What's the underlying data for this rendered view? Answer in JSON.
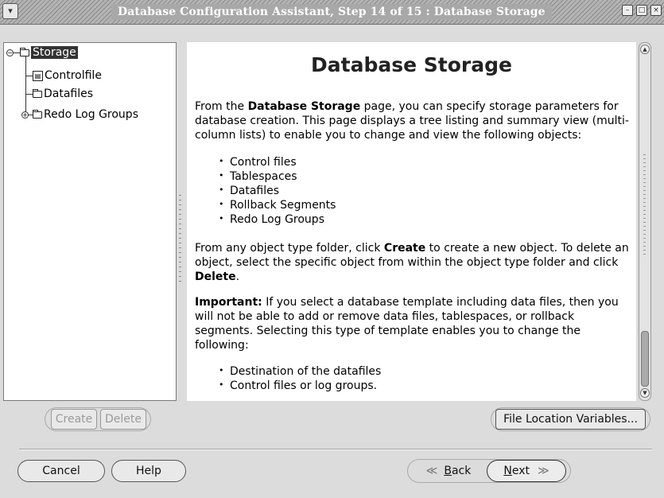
{
  "window": {
    "title": "Database Configuration Assistant, Step 14 of 15 : Database Storage",
    "menu_glyph": "▾",
    "minimize_glyph": "–",
    "maximize_glyph": "□",
    "close_glyph": "×"
  },
  "tree": {
    "root_label": "Storage",
    "items": [
      {
        "label": "Controlfile",
        "icon": "controlfile-icon"
      },
      {
        "label": "Datafiles",
        "icon": "folder-icon"
      },
      {
        "label": "Redo Log Groups",
        "icon": "folder-icon",
        "expandable": true
      }
    ],
    "collapse_glyph": "−",
    "expand_glyph": "+"
  },
  "help": {
    "heading": "Database Storage",
    "p1_pre": "From the ",
    "p1_bold": "Database Storage",
    "p1_post": " page, you can specify storage parameters for database creation. This page displays a tree listing and summary view (multi-column lists) to enable you to change and view the following objects:",
    "list1": [
      "Control files",
      "Tablespaces",
      "Datafiles",
      "Rollback Segments",
      "Redo Log Groups"
    ],
    "p2_pre": "From any object type folder, click ",
    "p2_bold1": "Create",
    "p2_mid": " to create a new object. To delete an object, select the specific object from within the object type folder and click ",
    "p2_bold2": "Delete",
    "p2_post": ".",
    "p3_bold": "Important:",
    "p3_post": " If you select a database template including data files, then you will not be able to add or remove data files, tablespaces, or rollback segments. Selecting this type of template enables you to change the following:",
    "list2": [
      "Destination of the datafiles",
      "Control files or log groups."
    ]
  },
  "buttons": {
    "create": "Create",
    "delete": "Delete",
    "file_location_variables": "File Location Variables...",
    "cancel": "Cancel",
    "help": "Help",
    "back_glyph": "≪",
    "back_mnemonic": "B",
    "back_rest": "ack",
    "next_mnemonic": "N",
    "next_rest": "ext",
    "next_glyph": "≫"
  }
}
